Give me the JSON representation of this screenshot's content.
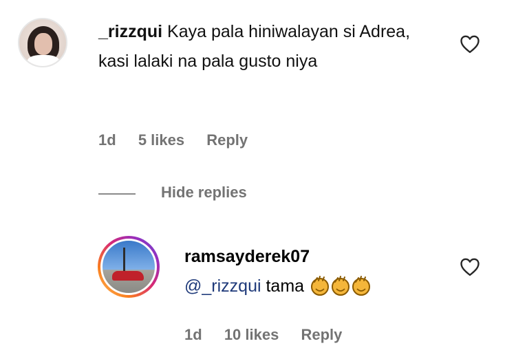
{
  "comment": {
    "username": "_rizzqui",
    "text": "Kaya pala hiniwalayan si Adrea, kasi lalaki na pala gusto niya",
    "time": "1d",
    "likes": "5 likes",
    "reply_label": "Reply",
    "avatar_icon": "user-avatar"
  },
  "replies_toggle": {
    "label": "Hide replies"
  },
  "reply": {
    "username": "ramsayderek07",
    "mention": "@_rizzqui",
    "text": "tama",
    "emoji": [
      "clapping-hands-emoji",
      "clapping-hands-emoji",
      "clapping-hands-emoji"
    ],
    "time": "1d",
    "likes": "10 likes",
    "reply_label": "Reply",
    "avatar_icon": "user-avatar-story-ring"
  },
  "colors": {
    "meta": "#737373",
    "mention": "#1f3a7a",
    "story_ring": [
      "#fdc468",
      "#fa7e1e",
      "#d62976",
      "#962fbf",
      "#4f5bd5"
    ]
  },
  "icons": {
    "like": "heart-outline-icon"
  }
}
